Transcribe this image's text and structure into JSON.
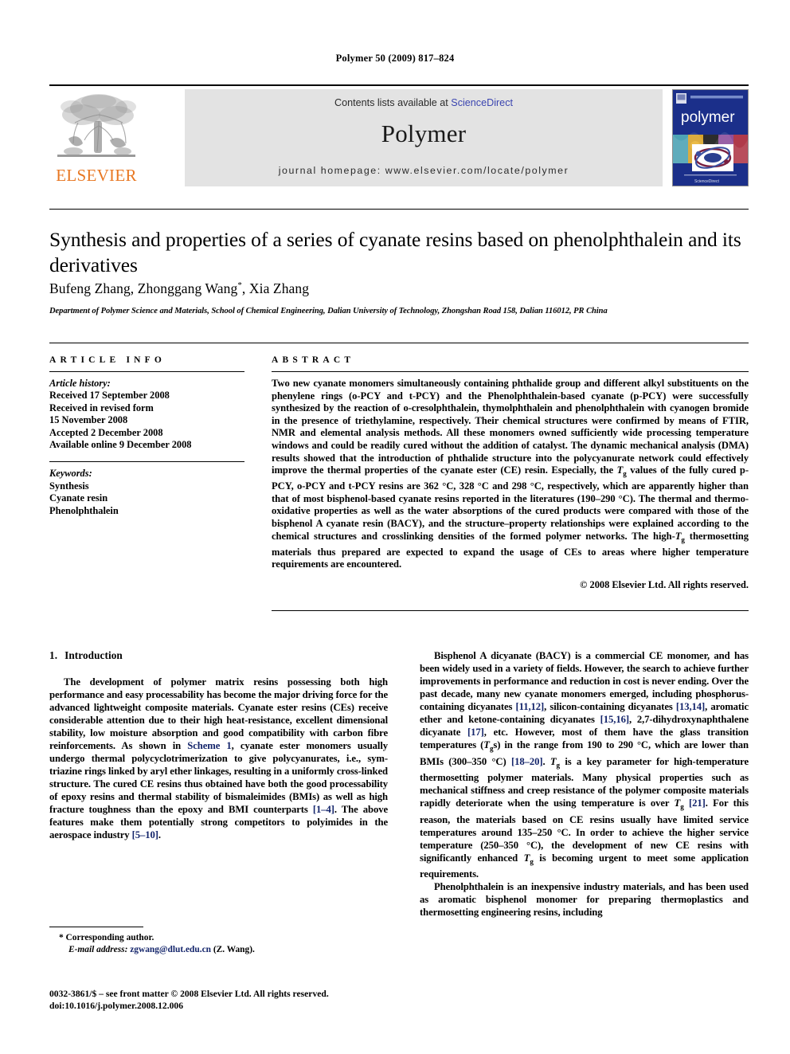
{
  "running_head": "Polymer 50 (2009) 817–824",
  "masthead": {
    "elsevier_wordmark": "ELSEVIER",
    "contents_prefix": "Contents lists available at ",
    "contents_link": "ScienceDirect",
    "journal_name": "Polymer",
    "homepage": "journal homepage: www.elsevier.com/locate/polymer",
    "cover_title": "polymer",
    "cover_footer": "ScienceDirect",
    "link_color": "#3b45b0",
    "elsevier_orange": "#E87722",
    "cover_blue": "#1b2f8a"
  },
  "article": {
    "title": "Synthesis and properties of a series of cyanate resins based on phenolphthalein and its derivatives",
    "authors_html": "Bufeng Zhang, Zhonggang Wang<sup>*</sup>, Xia Zhang",
    "affiliation": "Department of Polymer Science and Materials, School of Chemical Engineering, Dalian University of Technology, Zhongshan Road 158, Dalian 116012, PR China"
  },
  "article_info": {
    "heading": "ARTICLE INFO",
    "history_label": "Article history:",
    "history": [
      "Received 17 September 2008",
      "Received in revised form",
      "15 November 2008",
      "Accepted 2 December 2008",
      "Available online 9 December 2008"
    ],
    "keywords_label": "Keywords:",
    "keywords": [
      "Synthesis",
      "Cyanate resin",
      "Phenolphthalein"
    ]
  },
  "abstract": {
    "heading": "ABSTRACT",
    "text_html": "Two new cyanate monomers simultaneously containing phthalide group and different alkyl substituents on the phenylene rings (o-PCY and t-PCY) and the Phenolphthalein-based cyanate (p-PCY) were successfully synthesized by the reaction of o-cresolphthalein, thymolphthalein and phenolphthalein with cyanogen bromide in the presence of triethylamine, respectively. Their chemical structures were confirmed by means of FTIR, NMR and elemental analysis methods. All these monomers owned sufficiently wide processing temperature windows and could be readily cured without the addition of catalyst. The dynamic mechanical analysis (DMA) results showed that the introduction of phthalide structure into the polycyanurate network could effectively improve the thermal properties of the cyanate ester (CE) resin. Especially, the <span class=\"ital\">T</span><sub>g</sub> values of the fully cured p-PCY, o-PCY and t-PCY resins are 362 &deg;C, 328 &deg;C and 298 &deg;C, respectively, which are apparently higher than that of most bisphenol-based cyanate resins reported in the literatures (190&ndash;290 &deg;C). The thermal and thermo-oxidative properties as well as the water absorptions of the cured products were compared with those of the bisphenol A cyanate resin (BACY), and the structure&ndash;property relationships were explained according to the chemical structures and crosslinking densities of the formed polymer networks. The high-<span class=\"ital\">T</span><sub>g</sub> thermosetting materials thus prepared are expected to expand the usage of CEs to areas where higher temperature requirements are encountered.",
    "copyright": "&copy; 2008 Elsevier Ltd. All rights reserved."
  },
  "introduction": {
    "section_number": "1.",
    "section_title": "Introduction",
    "left_paragraph_html": "The development of polymer matrix resins possessing both high performance and easy processability has become the major driving force for the advanced lightweight composite materials. Cyanate ester resins (CEs) receive considerable attention due to their high heat-resistance, excellent dimensional stability, low moisture absorption and good compatibility with carbon fibre reinforcements. As shown in <span class=\"lnk\">Scheme 1</span>, cyanate ester monomers usually undergo thermal polycyclotrimerization to give polycyanurates, i.e., sym-triazine rings linked by aryl ether linkages, resulting in a uniformly cross-linked structure. The cured CE resins thus obtained have both the good processability of epoxy resins and thermal stability of bismaleimides (BMIs) as well as high fracture toughness than the epoxy and BMI counterparts <span class=\"ref\">[1&ndash;4]</span>. The above features make them potentially strong competitors to polyimides in the aerospace industry <span class=\"ref\">[5&ndash;10]</span>.",
    "right_paragraph_1_html": "Bisphenol A dicyanate (BACY) is a commercial CE monomer, and has been widely used in a variety of fields. However, the search to achieve further improvements in performance and reduction in cost is never ending. Over the past decade, many new cyanate monomers emerged, including phosphorus-containing dicyanates <span class=\"ref\">[11,12]</span>, silicon-containing dicyanates <span class=\"ref\">[13,14]</span>, aromatic ether and ketone-containing dicyanates <span class=\"ref\">[15,16]</span>, 2,7-dihydroxynaphthalene dicyanate <span class=\"ref\">[17]</span>, etc. However, most of them have the glass transition temperatures (<span class=\"ital\">T</span><sub>g</sub>s) in the range from 190 to 290 &deg;C, which are lower than BMIs (300&ndash;350 &deg;C) <span class=\"ref\">[18&ndash;20]</span>. <span class=\"ital\">T</span><sub>g</sub> is a key parameter for high-temperature thermosetting polymer materials. Many physical properties such as mechanical stiffness and creep resistance of the polymer composite materials rapidly deteriorate when the using temperature is over <span class=\"ital\">T</span><sub>g</sub> <span class=\"ref\">[21]</span>. For this reason, the materials based on CE resins usually have limited service temperatures around 135&ndash;250 &deg;C. In order to achieve the higher service temperature (250&ndash;350 &deg;C), the development of new CE resins with significantly enhanced <span class=\"ital\">T</span><sub>g</sub> is becoming urgent to meet some application requirements.",
    "right_paragraph_2_html": "Phenolphthalein is an inexpensive industry materials, and has been used as aromatic bisphenol monomer for preparing thermoplastics and thermosetting engineering resins, including"
  },
  "footnote": {
    "corresponding": "* Corresponding author.",
    "email_label": "E-mail address:",
    "email": "zgwang@dlut.edu.cn",
    "email_suffix": "(Z. Wang).",
    "email_color": "#14256b"
  },
  "imprint": {
    "line1": "0032-3861/$ – see front matter © 2008 Elsevier Ltd. All rights reserved.",
    "line2": "doi:10.1016/j.polymer.2008.12.006"
  }
}
